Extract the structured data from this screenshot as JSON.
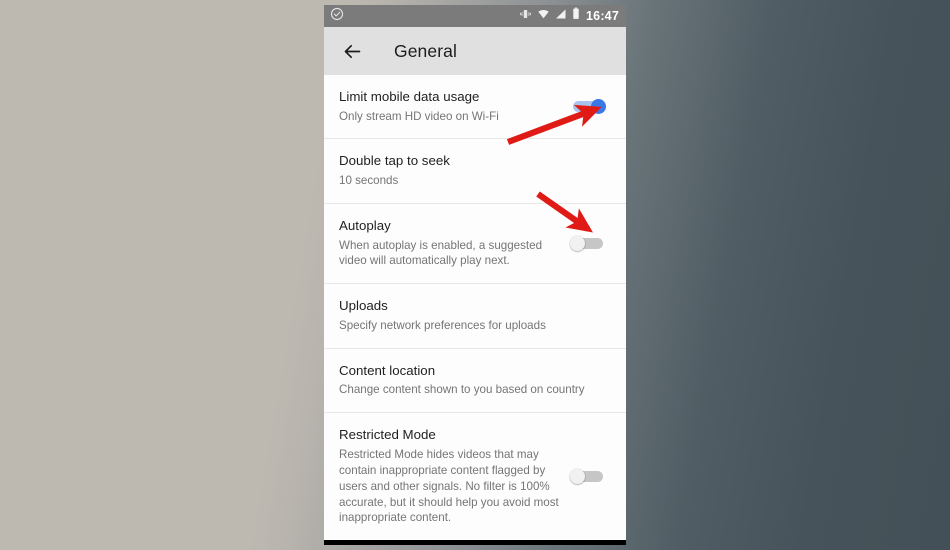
{
  "statusbar": {
    "notification_icon": "check-circle-icon",
    "icons": [
      "vibrate-icon",
      "wifi-icon",
      "cellular-signal-icon",
      "battery-icon"
    ],
    "time": "16:47"
  },
  "appbar": {
    "back_icon": "back-arrow-icon",
    "title": "General"
  },
  "settings": [
    {
      "name": "limit-mobile-data-usage",
      "title": "Limit mobile data usage",
      "subtitle": "Only stream HD video on Wi-Fi",
      "toggle": "on"
    },
    {
      "name": "double-tap-to-seek",
      "title": "Double tap to seek",
      "subtitle": "10 seconds",
      "toggle": "none"
    },
    {
      "name": "autoplay",
      "title": "Autoplay",
      "subtitle": "When autoplay is enabled, a suggested video will automatically play next.",
      "toggle": "off"
    },
    {
      "name": "uploads",
      "title": "Uploads",
      "subtitle": "Specify network preferences for uploads",
      "toggle": "none"
    },
    {
      "name": "content-location",
      "title": "Content location",
      "subtitle": "Change content shown to you based on country",
      "toggle": "none"
    },
    {
      "name": "restricted-mode",
      "title": "Restricted Mode",
      "subtitle": "Restricted Mode hides videos that may contain inappropriate content flagged by users and other signals. No filter is 100% accurate, but it should help you avoid most inappropriate content.",
      "toggle": "off"
    }
  ],
  "navbar": {
    "back": "back-triangle-icon",
    "home": "home-circle-icon",
    "recents": "recents-square-icon"
  },
  "annotations": {
    "color": "#e01b16",
    "arrows": [
      {
        "name": "arrow-to-limit-data-toggle",
        "points_to": "limit-mobile-data-usage-toggle"
      },
      {
        "name": "arrow-to-autoplay-toggle",
        "points_to": "autoplay-toggle"
      }
    ]
  },
  "colors": {
    "statusbar_bg": "#7b7b7b",
    "appbar_bg": "#e0e0e0",
    "toggle_on_knob": "#3b78e7",
    "toggle_on_track": "#a8c3f0",
    "toggle_off_track": "#c6c6c6",
    "navbar_bg": "#000000",
    "annotation_red": "#e01b16"
  }
}
